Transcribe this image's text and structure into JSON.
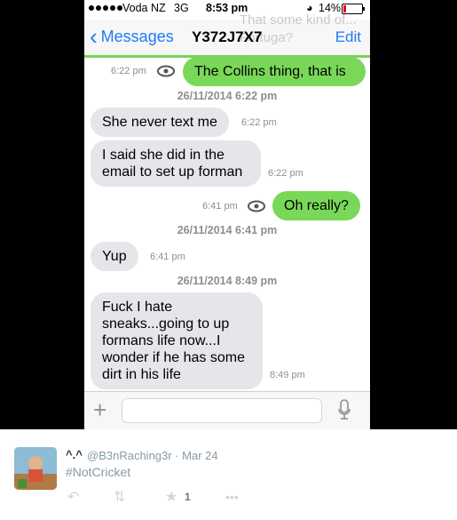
{
  "status": {
    "carrier": "Voda NZ",
    "network": "3G",
    "time": "8:53 pm",
    "battery": "14%"
  },
  "nav": {
    "back_label": "Messages",
    "title": "Y372J7X7",
    "edit_label": "Edit",
    "ghost_text": "That some kind of... Fortuga?"
  },
  "messages": [
    {
      "dir": "out",
      "text": "The Collins thing, that is",
      "time": "6:22 pm"
    },
    {
      "dir": "sep",
      "date": "26/11/2014",
      "time": "6:22 pm"
    },
    {
      "dir": "in",
      "text": "She never text me",
      "time": "6:22 pm"
    },
    {
      "dir": "in",
      "text": "I said she did in the email to set up forman",
      "time": "6:22 pm"
    },
    {
      "dir": "out",
      "text": "Oh really?",
      "time": "6:41 pm"
    },
    {
      "dir": "sep",
      "date": "26/11/2014",
      "time": "6:41 pm"
    },
    {
      "dir": "in",
      "text": "Yup",
      "time": "6:41 pm"
    },
    {
      "dir": "sep",
      "date": "26/11/2014",
      "time": "8:49 pm"
    },
    {
      "dir": "in",
      "text": "Fuck I hate sneaks...going to up formans life now...I wonder if he has some dirt in his life",
      "time": "8:49 pm"
    }
  ],
  "tweet": {
    "name": "^.^",
    "handle": "@B3nRaching3r · Mar 24",
    "text": "#NotCricket",
    "favorites": "1"
  },
  "colors": {
    "ios_blue": "#1f7bf6",
    "outgoing_green": "#79d858",
    "incoming_gray": "#e5e5ea"
  }
}
